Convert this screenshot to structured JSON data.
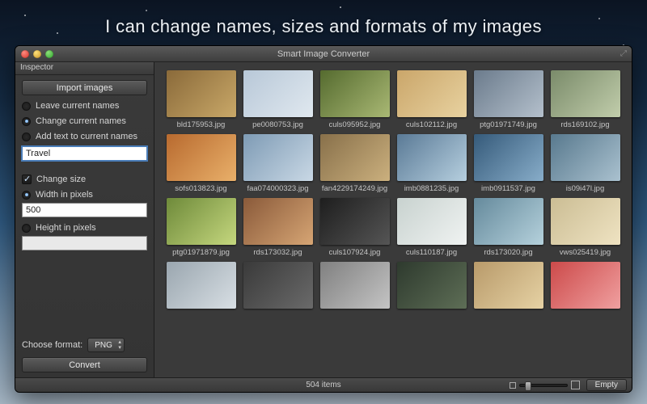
{
  "headline": "I can change names, sizes and formats of my images",
  "window": {
    "title": "Smart Image Converter"
  },
  "sidebar": {
    "inspector_label": "Inspector",
    "import_button": "Import images",
    "name_mode": {
      "option_leave": "Leave current names",
      "option_change": "Change current names",
      "option_add": "Add text to current names",
      "selected": "change",
      "text_value": "Travel"
    },
    "size": {
      "checkbox_label": "Change size",
      "checked": true,
      "width_label": "Width in pixels",
      "width_value": "500",
      "height_label": "Height in pixels",
      "height_value": "",
      "dimension_selected": "width"
    },
    "format": {
      "label": "Choose format:",
      "value": "PNG"
    },
    "convert_button": "Convert"
  },
  "grid": {
    "items": [
      {
        "file": "bld175953.jpg"
      },
      {
        "file": "pe0080753.jpg"
      },
      {
        "file": "culs095952.jpg"
      },
      {
        "file": "culs102112.jpg"
      },
      {
        "file": "ptg01971749.jpg"
      },
      {
        "file": "rds169102.jpg"
      },
      {
        "file": "sofs013823.jpg"
      },
      {
        "file": "faa074000323.jpg"
      },
      {
        "file": "fan4229174249.jpg"
      },
      {
        "file": "imb0881235.jpg"
      },
      {
        "file": "imb0911537.jpg"
      },
      {
        "file": "is09i47l.jpg"
      },
      {
        "file": "ptg01971879.jpg"
      },
      {
        "file": "rds173032.jpg"
      },
      {
        "file": "culs107924.jpg"
      },
      {
        "file": "culs110187.jpg"
      },
      {
        "file": "rds173020.jpg"
      },
      {
        "file": "vws025419.jpg"
      },
      {
        "file": ""
      },
      {
        "file": ""
      },
      {
        "file": ""
      },
      {
        "file": ""
      },
      {
        "file": ""
      },
      {
        "file": ""
      }
    ]
  },
  "statusbar": {
    "count_label": "504 items",
    "empty_button": "Empty"
  }
}
